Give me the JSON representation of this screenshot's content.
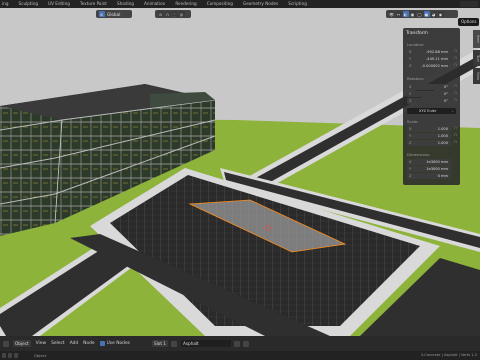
{
  "workspace_tabs": [
    "ing",
    "Sculpting",
    "UV Editing",
    "Texture Paint",
    "Shading",
    "Animation",
    "Rendering",
    "Compositing",
    "Geometry Nodes",
    "Scripting"
  ],
  "viewport_header": {
    "orientation": "Global",
    "tooltip": "Options"
  },
  "npanel": {
    "panel_title": "Transform",
    "location_label": "Location:",
    "location": [
      {
        "axis": "X",
        "value": "-902.88 mm"
      },
      {
        "axis": "Y",
        "value": "-449.11 mm"
      },
      {
        "axis": "Z",
        "value": "-0.000002 mm"
      }
    ],
    "rotation_label": "Rotation:",
    "rotation": [
      {
        "axis": "X",
        "value": "0°"
      },
      {
        "axis": "Y",
        "value": "0°"
      },
      {
        "axis": "Z",
        "value": "0°"
      }
    ],
    "rotation_mode": "XYZ Euler",
    "scale_label": "Scale:",
    "scale": [
      {
        "axis": "X",
        "value": "1.000"
      },
      {
        "axis": "Y",
        "value": "1.000"
      },
      {
        "axis": "Z",
        "value": "1.000"
      }
    ],
    "dimensions_label": "Dimensions:",
    "dimensions": [
      {
        "axis": "X",
        "value": "1e3000 mm"
      },
      {
        "axis": "Y",
        "value": "1e3000 mm"
      },
      {
        "axis": "Z",
        "value": "0 mm"
      }
    ],
    "side_tabs": [
      "Item",
      "Tool",
      "View"
    ]
  },
  "shader_header": {
    "editor_type": "Object",
    "menus": [
      "View",
      "Select",
      "Add",
      "Node"
    ],
    "use_nodes_label": "Use Nodes",
    "slot": "Slot 1",
    "material": "Asphalt"
  },
  "status_bar": {
    "left": "Object",
    "right": "3-Concrete | Asphalt | Verts 1,2"
  },
  "colors": {
    "grass": "#8db33b",
    "asphalt": "#2f2f2f",
    "sidewalk": "#d9d9d9",
    "sky": "#c9c9c9",
    "selection": "#ff8c1a",
    "accent": "#4772b3"
  }
}
